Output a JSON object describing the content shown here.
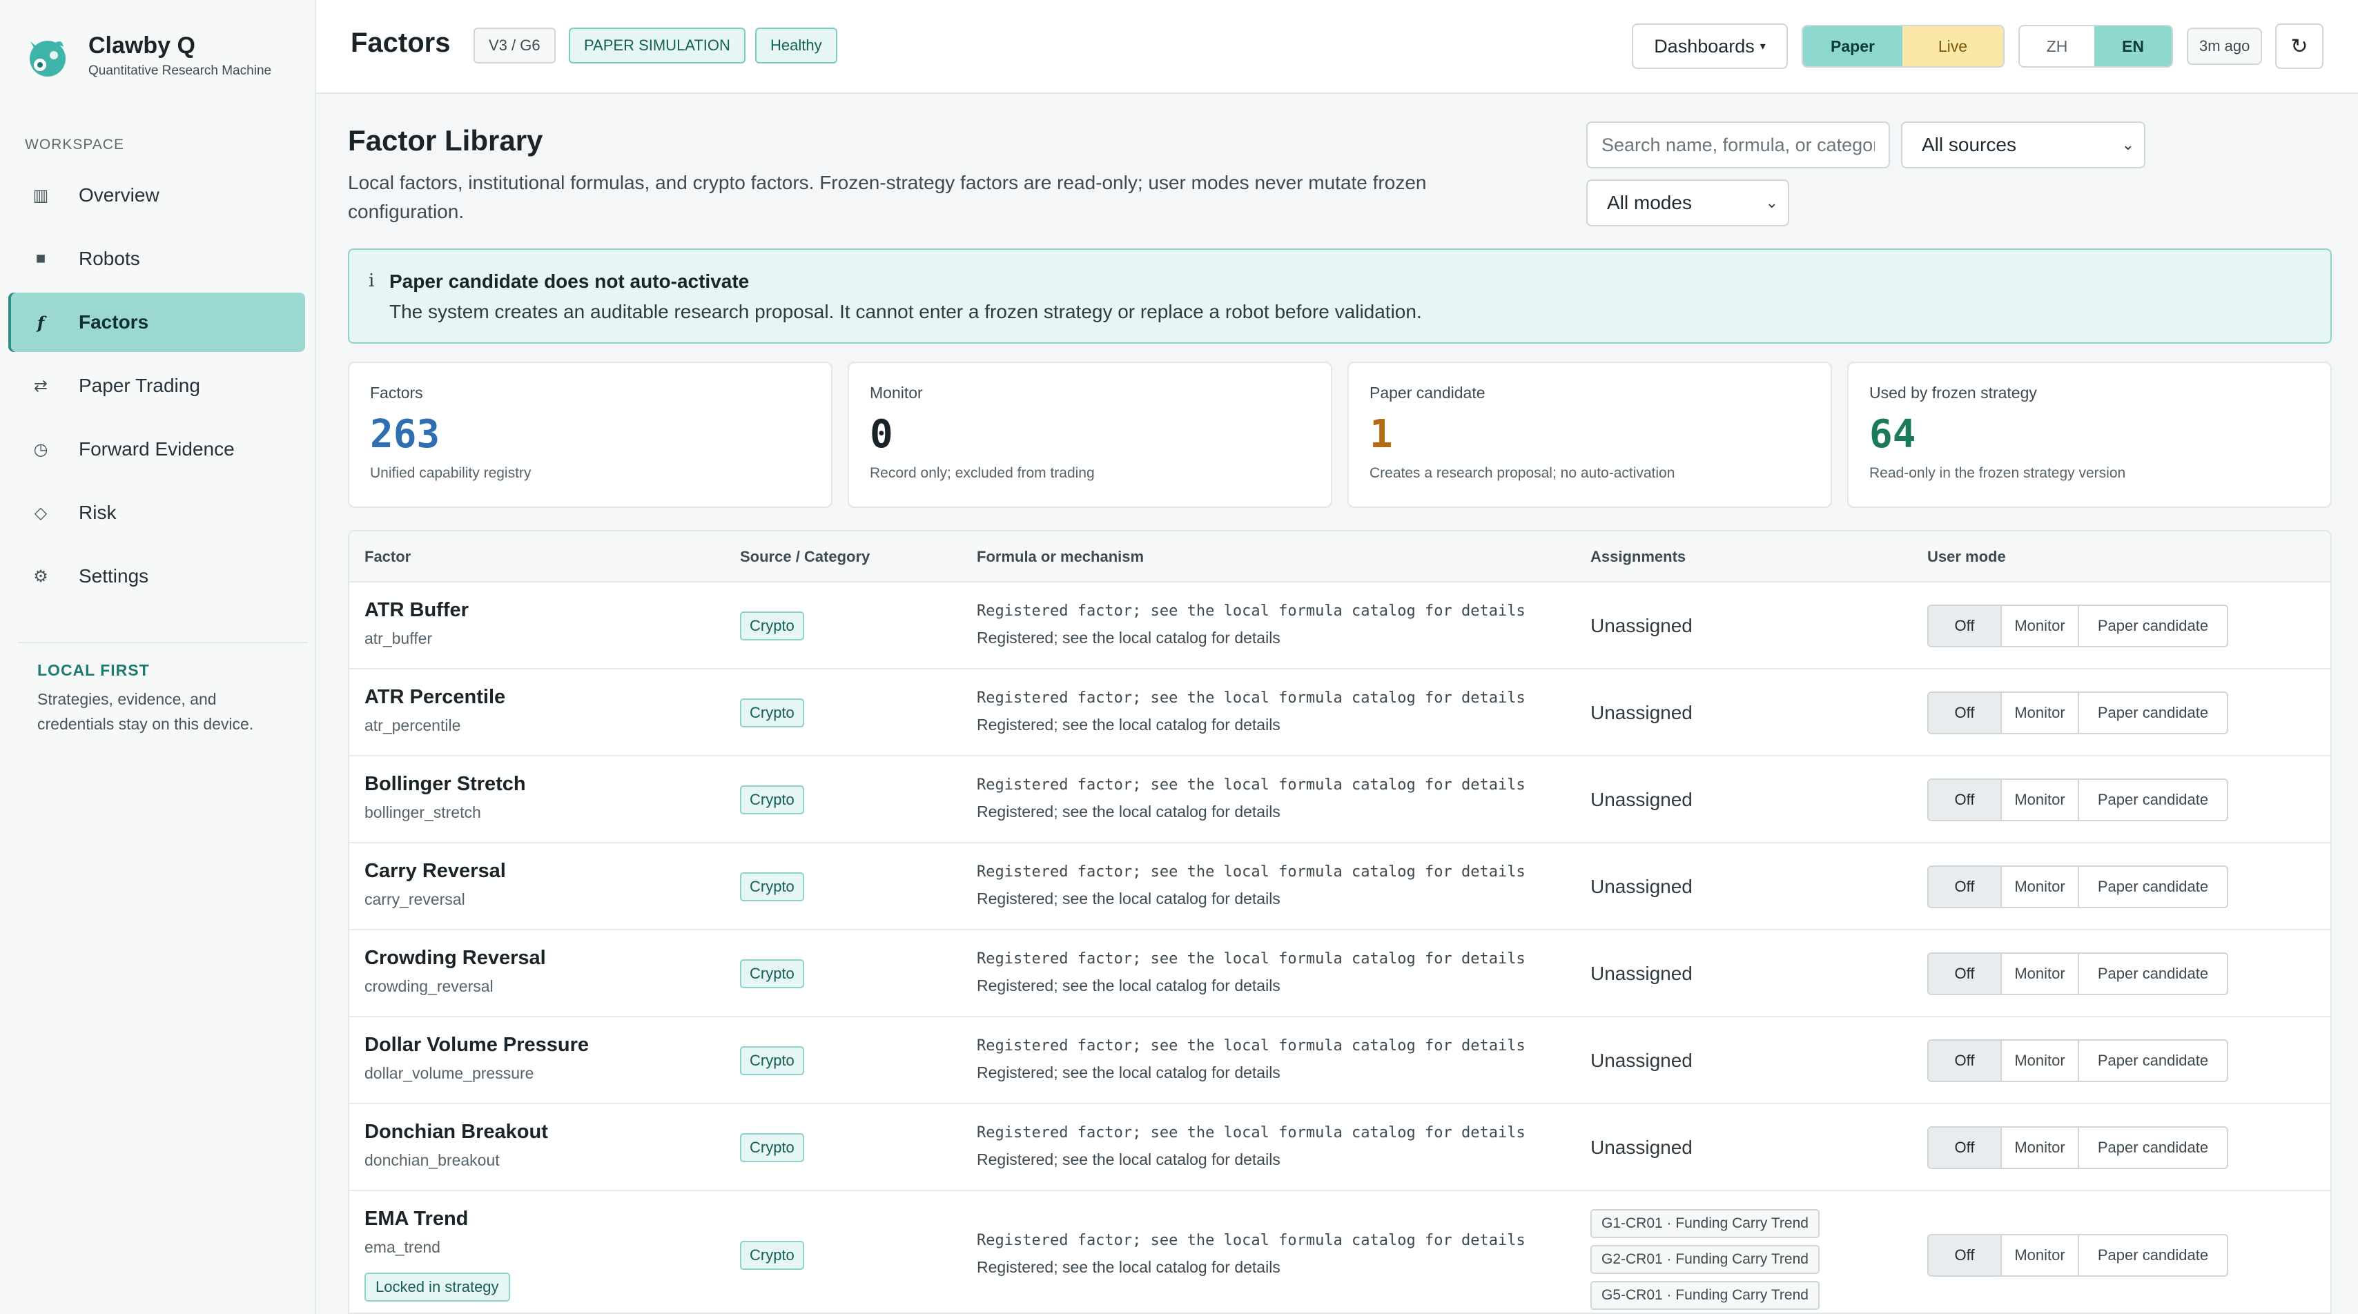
{
  "brand": {
    "name": "Clawby Q",
    "subtitle": "Quantitative Research Machine"
  },
  "sidebar": {
    "section_label": "WORKSPACE",
    "items": [
      {
        "label": "Overview",
        "icon": "▥",
        "icon_name": "grid-icon"
      },
      {
        "label": "Robots",
        "icon": "■",
        "icon_name": "robot-icon"
      },
      {
        "label": "Factors",
        "icon": "f",
        "icon_name": "function-icon",
        "active": true
      },
      {
        "label": "Paper Trading",
        "icon": "⇄",
        "icon_name": "swap-icon"
      },
      {
        "label": "Forward Evidence",
        "icon": "◷",
        "icon_name": "clock-icon"
      },
      {
        "label": "Risk",
        "icon": "◇",
        "icon_name": "diamond-icon"
      },
      {
        "label": "Settings",
        "icon": "⚙",
        "icon_name": "gear-icon"
      }
    ],
    "local_first": {
      "title": "LOCAL FIRST",
      "text": "Strategies, evidence, and credentials stay on this device."
    }
  },
  "header": {
    "title": "Factors",
    "version_chip": "V3 / G6",
    "mode_chip": "PAPER SIMULATION",
    "health_chip": "Healthy",
    "dashboards_label": "Dashboards",
    "dashboards_caret": "▾",
    "env": {
      "paper": "Paper",
      "live": "Live"
    },
    "lang": {
      "zh": "ZH",
      "en": "EN"
    },
    "updated": "3m ago",
    "refresh_icon": "↻"
  },
  "library": {
    "title": "Factor Library",
    "description": "Local factors, institutional formulas, and crypto factors. Frozen-strategy factors are read-only; user modes never mutate frozen configuration.",
    "search_placeholder": "Search name, formula, or category",
    "source_filter": "All sources",
    "mode_filter": "All modes",
    "caret": "⌄"
  },
  "alert": {
    "icon": "i",
    "title": "Paper candidate does not auto-activate",
    "text": "The system creates an auditable research proposal. It cannot enter a frozen strategy or replace a robot before validation."
  },
  "stats": [
    {
      "label": "Factors",
      "value": "263",
      "note": "Unified capability registry",
      "color": "#2f6fb1"
    },
    {
      "label": "Monitor",
      "value": "0",
      "note": "Record only; excluded from trading",
      "color": "#1a2328"
    },
    {
      "label": "Paper candidate",
      "value": "1",
      "note": "Creates a research proposal; no auto-activation",
      "color": "#b26b12"
    },
    {
      "label": "Used by frozen strategy",
      "value": "64",
      "note": "Read-only in the frozen strategy version",
      "color": "#1b7a5c"
    }
  ],
  "table": {
    "columns": [
      "Factor",
      "Source / Category",
      "Formula or mechanism",
      "Assignments",
      "User mode"
    ],
    "mode_options": [
      "Off",
      "Monitor",
      "Paper candidate"
    ],
    "rows": [
      {
        "name": "ATR Buffer",
        "id": "atr_buffer",
        "category": "Crypto",
        "formula": "Registered factor; see the local formula catalog for details",
        "formula_note": "Registered; see the local catalog for details",
        "assignment": "Unassigned",
        "mode": "Off"
      },
      {
        "name": "ATR Percentile",
        "id": "atr_percentile",
        "category": "Crypto",
        "formula": "Registered factor; see the local formula catalog for details",
        "formula_note": "Registered; see the local catalog for details",
        "assignment": "Unassigned",
        "mode": "Off"
      },
      {
        "name": "Bollinger Stretch",
        "id": "bollinger_stretch",
        "category": "Crypto",
        "formula": "Registered factor; see the local formula catalog for details",
        "formula_note": "Registered; see the local catalog for details",
        "assignment": "Unassigned",
        "mode": "Off"
      },
      {
        "name": "Carry Reversal",
        "id": "carry_reversal",
        "category": "Crypto",
        "formula": "Registered factor; see the local formula catalog for details",
        "formula_note": "Registered; see the local catalog for details",
        "assignment": "Unassigned",
        "mode": "Off"
      },
      {
        "name": "Crowding Reversal",
        "id": "crowding_reversal",
        "category": "Crypto",
        "formula": "Registered factor; see the local formula catalog for details",
        "formula_note": "Registered; see the local catalog for details",
        "assignment": "Unassigned",
        "mode": "Off"
      },
      {
        "name": "Dollar Volume Pressure",
        "id": "dollar_volume_pressure",
        "category": "Crypto",
        "formula": "Registered factor; see the local formula catalog for details",
        "formula_note": "Registered; see the local catalog for details",
        "assignment": "Unassigned",
        "mode": "Off"
      },
      {
        "name": "Donchian Breakout",
        "id": "donchian_breakout",
        "category": "Crypto",
        "formula": "Registered factor; see the local formula catalog for details",
        "formula_note": "Registered; see the local catalog for details",
        "assignment": "Unassigned",
        "mode": "Off"
      },
      {
        "name": "EMA Trend",
        "id": "ema_trend",
        "category": "Crypto",
        "formula": "Registered factor; see the local formula catalog for details",
        "formula_note": "Registered; see the local catalog for details",
        "locked": "Locked in strategy",
        "assignments": [
          "G1-CR01 · Funding Carry Trend",
          "G2-CR01 · Funding Carry Trend",
          "G5-CR01 · Funding Carry Trend"
        ],
        "mode": "Off"
      }
    ]
  }
}
